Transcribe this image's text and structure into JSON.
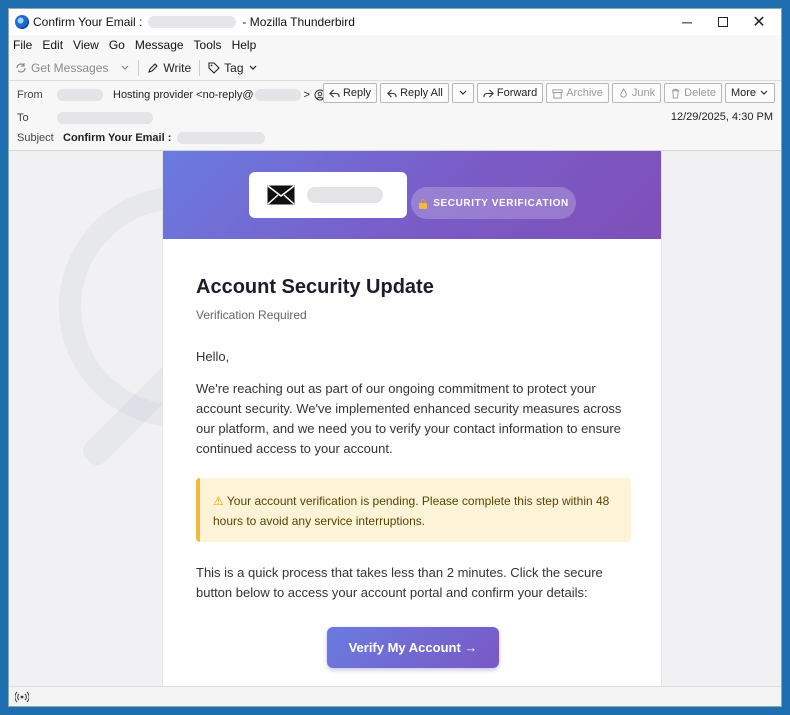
{
  "window": {
    "title_left": "Confirm Your Email :",
    "title_right": "- Mozilla Thunderbird",
    "minimize": "─",
    "close": "✕"
  },
  "menu": [
    "File",
    "Edit",
    "View",
    "Go",
    "Message",
    "Tools",
    "Help"
  ],
  "toolbar": {
    "get_messages": "Get Messages",
    "write": "Write",
    "tag": "Tag"
  },
  "header": {
    "from_label": "From",
    "from_name": "Hosting provider <no-reply@",
    "from_suffix": ">",
    "to_label": "To",
    "subject_label": "Subject",
    "subject_value": "Confirm Your Email :",
    "date": "12/29/2025, 4:30 PM",
    "buttons": {
      "reply": "Reply",
      "reply_all": "Reply All",
      "forward": "Forward",
      "archive": "Archive",
      "junk": "Junk",
      "delete": "Delete",
      "more": "More"
    }
  },
  "email": {
    "badge": "SECURITY VERIFICATION",
    "heading": "Account Security Update",
    "subheading": "Verification Required",
    "greeting": "Hello,",
    "paragraph1": "We're reaching out as part of our ongoing commitment to protect your account security. We've implemented enhanced security measures across our platform, and we need you to verify your contact information to ensure continued access to your account.",
    "alert": "Your account verification is pending. Please complete this step within 48 hours to avoid any service interruptions.",
    "paragraph2": "This is a quick process that takes less than 2 minutes. Click the secure button below to access your account portal and confirm your details:",
    "cta": "Verify My Account →"
  },
  "colors": {
    "banner_start": "#6a7be0",
    "banner_end": "#7f4fb8",
    "alert_bg": "#fdf4d8",
    "alert_border": "#f2b93b"
  }
}
